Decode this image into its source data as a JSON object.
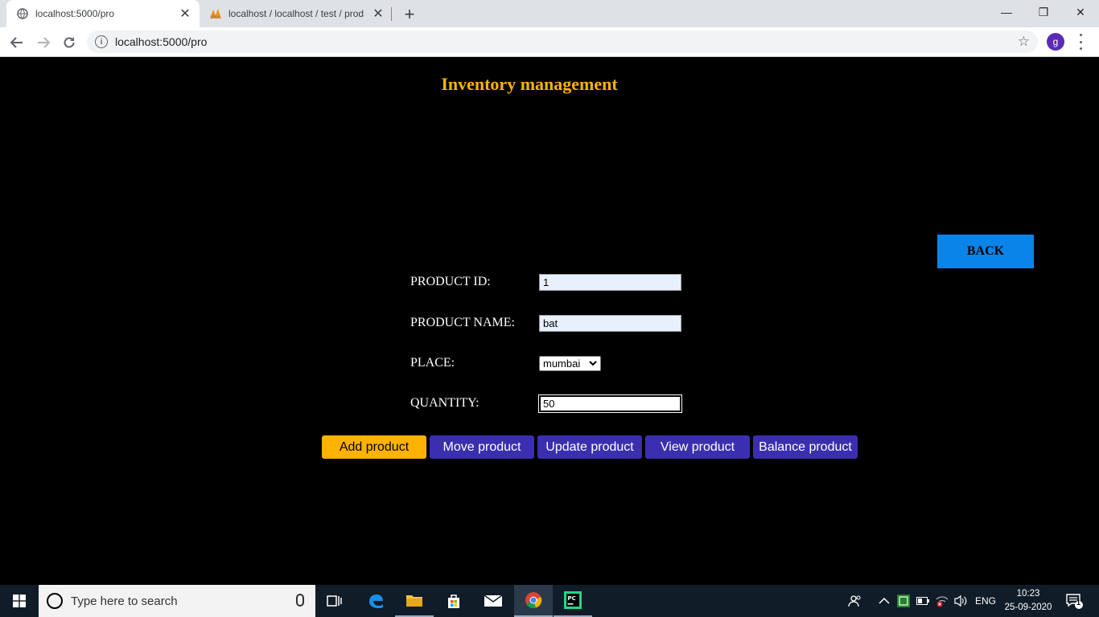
{
  "browser": {
    "tabs": [
      {
        "title": "localhost:5000/pro",
        "active": true
      },
      {
        "title": "localhost / localhost / test / prod",
        "active": false
      }
    ],
    "url": "localhost:5000/pro",
    "profile_initial": "g",
    "window_controls": {
      "minimize": "—",
      "restore": "❐",
      "close": "✕"
    }
  },
  "page": {
    "title": "Inventory management",
    "back_label": "BACK",
    "form": {
      "product_id": {
        "label": "PRODUCT ID:",
        "value": "1"
      },
      "product_name": {
        "label": "PRODUCT NAME:",
        "value": "bat"
      },
      "place": {
        "label": "PLACE:",
        "selected": "mumbai"
      },
      "quantity": {
        "label": "QUANTITY:",
        "value": "50"
      }
    },
    "actions": [
      {
        "label": "Add product"
      },
      {
        "label": "Move product"
      },
      {
        "label": "Update product"
      },
      {
        "label": "View product"
      },
      {
        "label": "Balance product"
      }
    ],
    "colors": {
      "title": "#ffb300",
      "back": "#0a84e8",
      "primary": "#ffb300",
      "secondary": "#3b2fb0"
    }
  },
  "taskbar": {
    "search_placeholder": "Type here to search",
    "language": "ENG",
    "time": "10:23",
    "date": "25-09-2020",
    "notification_count": "1",
    "apps": [
      "task-view",
      "edge",
      "file-explorer",
      "store",
      "mail",
      "chrome",
      "pycharm"
    ]
  }
}
